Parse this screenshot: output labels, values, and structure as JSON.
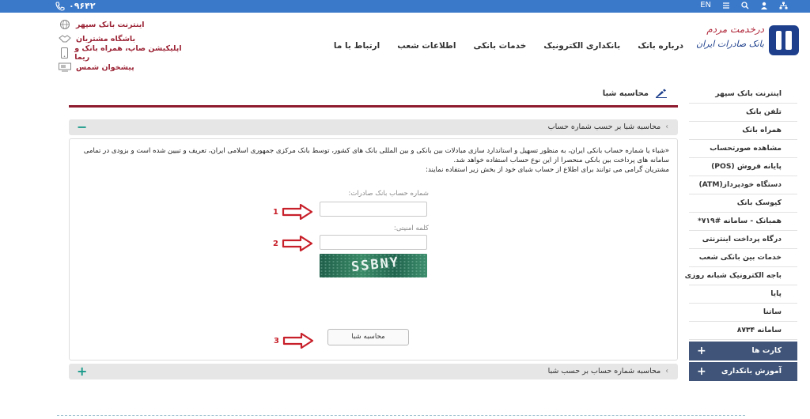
{
  "topbar": {
    "phone": "۰۹۶۴۲",
    "lang": "EN"
  },
  "logo": {
    "slogan": "درخدمت مردم",
    "name": "بانک صادرات ایران"
  },
  "nav": [
    "درباره بانک",
    "بانکداری الکترونیک",
    "خدمات بانکی",
    "اطلاعات شعب",
    "ارتباط با ما"
  ],
  "quick_links": [
    "اینترنت بانک سپهر",
    "باشگاه مشتریان",
    "اپلیکیشن صاپ، همراه بانک و ریما",
    "پیشخوان شمس"
  ],
  "breadcrumb": "محاسبه شبا",
  "accordion": {
    "first_title": "محاسبه شبا بر حسب شماره حساب",
    "first_toggle": "−",
    "second_title": "محاسبه شماره حساب بر حسب شبا",
    "second_toggle": "+"
  },
  "form": {
    "description": "«شباء یا شماره حساب  بانکی ایران، به منظور تسهیل و استاندارد سازی مبادلات بین بانکی و بین المللی بانک های کشور، توسط بانک مرکزی جمهوری اسلامی ایران، تعریف و تبیین شده است و بزودی در تمامی سامانه های پرداخت بین بانکی منحصرا از این نوع حساب استفاده خواهد شد.",
    "note": "مشتریان گرامی می توانند برای اطلاع از حساب شبای خود از بخش زیر استفاده نمایند:",
    "account_label": "شماره حساب بانک صادرات:",
    "security_label": "کلمه امنیتی:",
    "captcha_text": "SSBNY",
    "button_label": "محاسبه شبا"
  },
  "markers": [
    "1",
    "2",
    "3"
  ],
  "sidebar": {
    "items": [
      "اینترنت بانک سپهر",
      "تلفن بانک",
      "همراه بانک",
      "مشاهده صورتحساب",
      "پایانه فروش (POS)",
      "دستگاه خودپرداز(ATM)",
      "کیوسک بانک",
      "همبانک - سامانه #۷۱۹*",
      "درگاه پرداخت اینترنتی",
      "خدمات بین بانکی شعب",
      "باجه الکترونیک شبانه روزی",
      "پایا",
      "ساتنا",
      "سامانه ۸۷۳۴"
    ],
    "sections": [
      "کارت ها",
      "آموزش بانکداری الکترونیکی"
    ],
    "section_toggle": "+"
  },
  "colors": {
    "topbar": "#3a78c9",
    "accent_red": "#8e1b2e",
    "arrow_red": "#c8202a",
    "sidebar_dark": "#3f5478"
  }
}
